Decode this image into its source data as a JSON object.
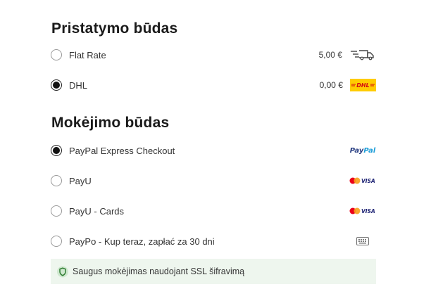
{
  "shipping": {
    "title": "Pristatymo būdas",
    "options": [
      {
        "label": "Flat Rate",
        "price": "5,00 €",
        "selected": false,
        "icon": "delivery-truck-icon"
      },
      {
        "label": "DHL",
        "price": "0,00 €",
        "selected": true,
        "icon": "dhl-logo"
      }
    ]
  },
  "payment": {
    "title": "Mokėjimo būdas",
    "options": [
      {
        "label": "PayPal Express Checkout",
        "selected": true,
        "logo_text": "PayPal",
        "logo": "paypal-logo"
      },
      {
        "label": "PayU",
        "selected": false,
        "logo_text": "VISA",
        "logo": "mastercard-visa-logo"
      },
      {
        "label": "PayU - Cards",
        "selected": false,
        "logo_text": "VISA",
        "logo": "mastercard-visa-logo"
      },
      {
        "label": "PayPo - Kup teraz, zapłać za 30 dni",
        "selected": false,
        "logo": "keyboard-icon"
      }
    ]
  },
  "secure_notice": {
    "text": "Saugus mokėjimas naudojant SSL šifravimą",
    "icon": "shield-icon"
  },
  "colors": {
    "dhl_yellow": "#ffcc00",
    "dhl_red": "#d40511",
    "paypal_dark": "#253b80",
    "paypal_light": "#179bd7",
    "secure_bg": "#eef6ee",
    "shield_green": "#2e7d32"
  }
}
